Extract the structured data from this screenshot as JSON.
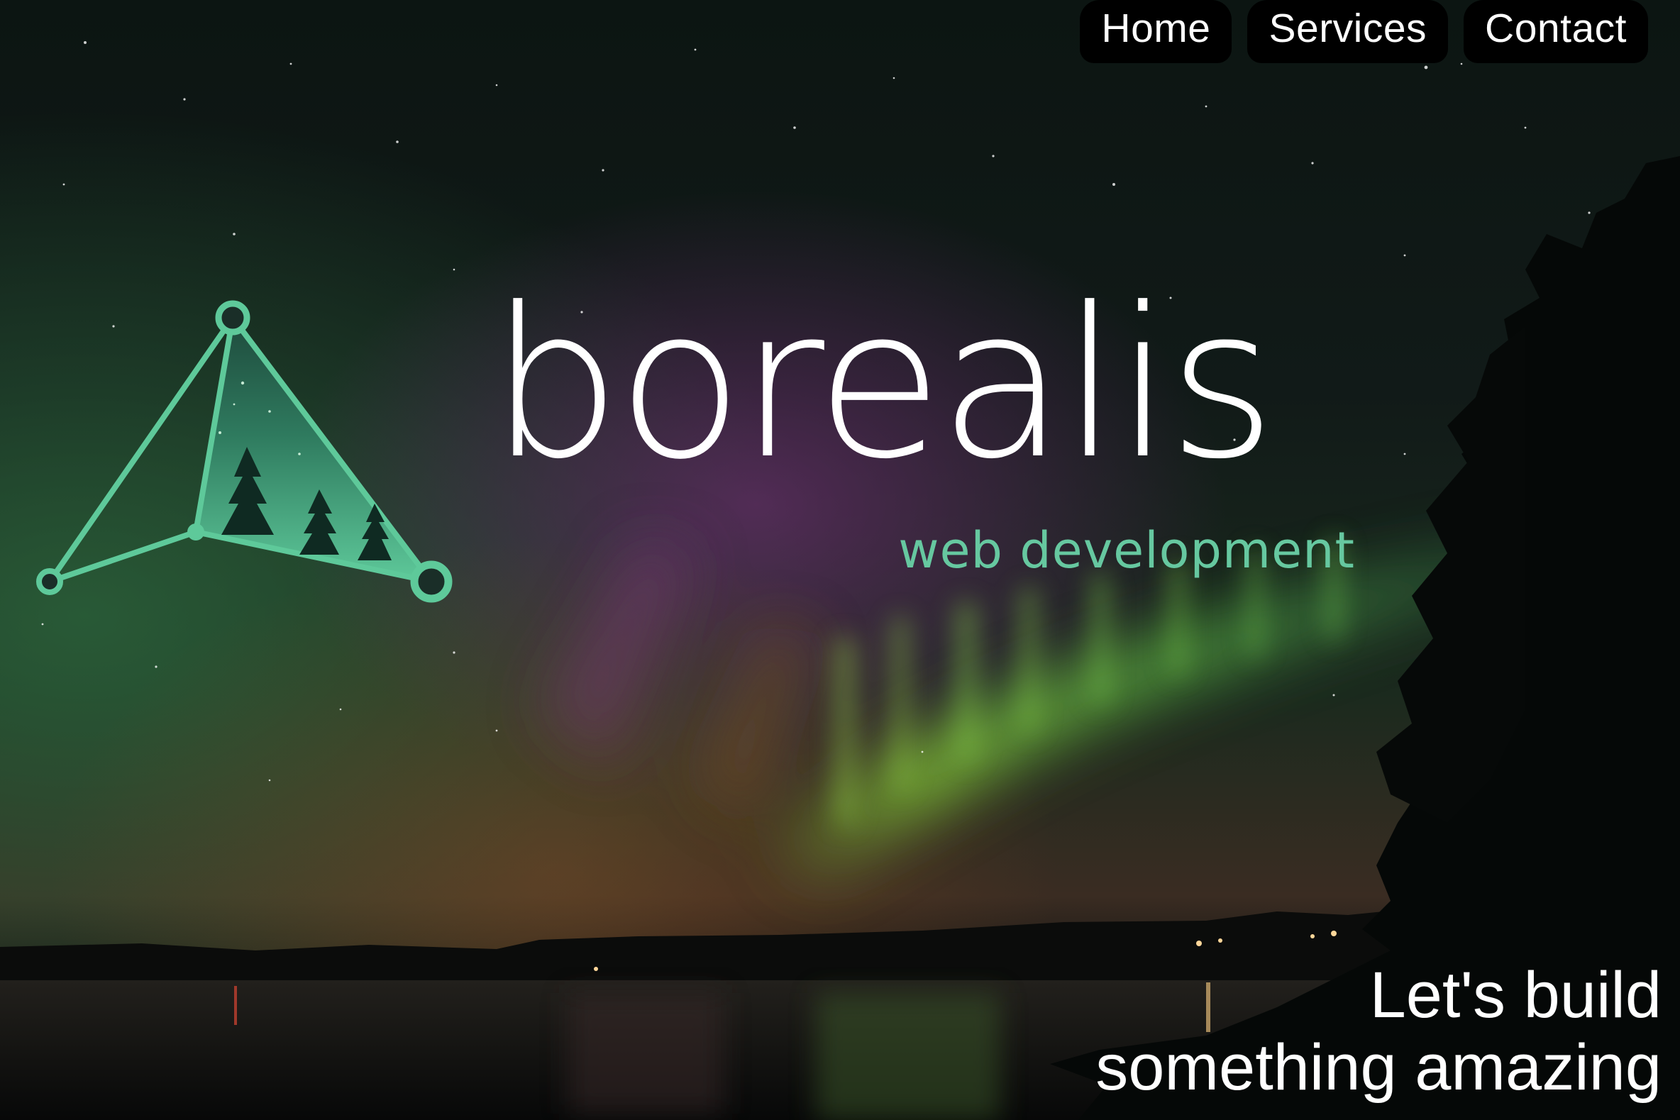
{
  "nav": {
    "items": [
      {
        "label": "Home"
      },
      {
        "label": "Services"
      },
      {
        "label": "Contact"
      }
    ]
  },
  "brand": {
    "name": "borealis",
    "tag": "web development"
  },
  "hero": {
    "line1": "Let's build",
    "line2": "something amazing"
  },
  "colors": {
    "accent": "#66c8a0",
    "text": "#ffffff",
    "nav_bg": "#000000"
  },
  "icons": {
    "logo": "constellation-triangle-logo"
  }
}
